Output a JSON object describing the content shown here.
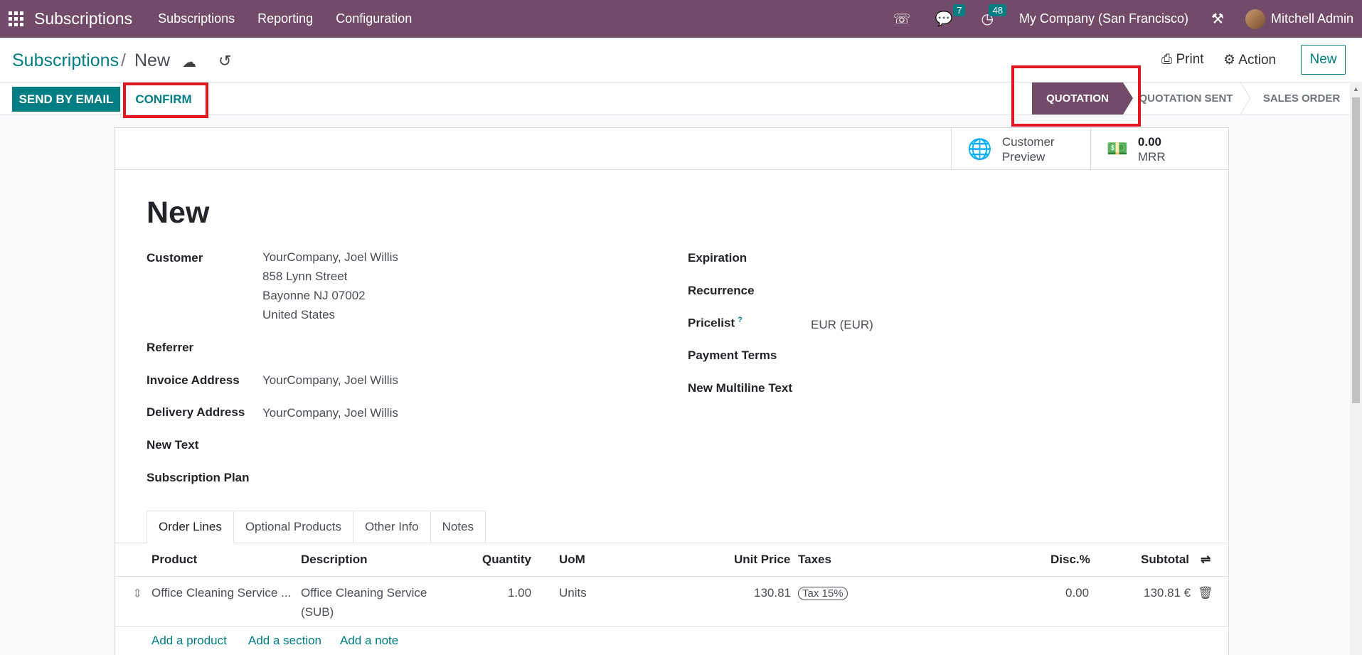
{
  "topbar": {
    "app_name": "Subscriptions",
    "menu": [
      "Subscriptions",
      "Reporting",
      "Configuration"
    ],
    "messages_count": "7",
    "activities_count": "48",
    "company": "My Company (San Francisco)",
    "user": "Mitchell Admin"
  },
  "breadcrumb": {
    "parent": "Subscriptions",
    "separator": "/",
    "current": "New"
  },
  "controls": {
    "print": "Print",
    "action": "Action",
    "new": "New"
  },
  "statusbar": {
    "send_email": "SEND BY EMAIL",
    "confirm": "CONFIRM",
    "stages": [
      "QUOTATION",
      "QUOTATION SENT",
      "SALES ORDER"
    ],
    "active_stage": "QUOTATION"
  },
  "smart_buttons": {
    "preview_line1": "Customer",
    "preview_line2": "Preview",
    "mrr_value": "0.00",
    "mrr_label": "MRR"
  },
  "form": {
    "title": "New",
    "customer_label": "Customer",
    "customer_name": "YourCompany, Joel Willis",
    "customer_street": "858 Lynn Street",
    "customer_city": "Bayonne NJ 07002",
    "customer_country": "United States",
    "referrer_label": "Referrer",
    "invoice_label": "Invoice Address",
    "invoice_value": "YourCompany, Joel Willis",
    "delivery_label": "Delivery Address",
    "delivery_value": "YourCompany, Joel Willis",
    "new_text_label": "New Text",
    "plan_label": "Subscription Plan",
    "expiration_label": "Expiration",
    "recurrence_label": "Recurrence",
    "pricelist_label": "Pricelist",
    "pricelist_help": "?",
    "pricelist_value": "EUR (EUR)",
    "payment_terms_label": "Payment Terms",
    "multiline_label": "New Multiline Text"
  },
  "tabs": [
    "Order Lines",
    "Optional Products",
    "Other Info",
    "Notes"
  ],
  "order_lines": {
    "columns": [
      "Product",
      "Description",
      "Quantity",
      "UoM",
      "Unit Price",
      "Taxes",
      "Disc.%",
      "Subtotal"
    ],
    "rows": [
      {
        "product": "Office Cleaning Service ...",
        "description_l1": "Office Cleaning Service",
        "description_l2": "(SUB)",
        "quantity": "1.00",
        "uom": "Units",
        "unit_price": "130.81",
        "tax": "Tax 15%",
        "discount": "0.00",
        "subtotal": "130.81 €"
      }
    ],
    "add_product": "Add a product",
    "add_section": "Add a section",
    "add_note": "Add a note"
  },
  "colors": {
    "brand": "#714b67",
    "accent": "#017e84",
    "highlight": "#e2161e"
  }
}
